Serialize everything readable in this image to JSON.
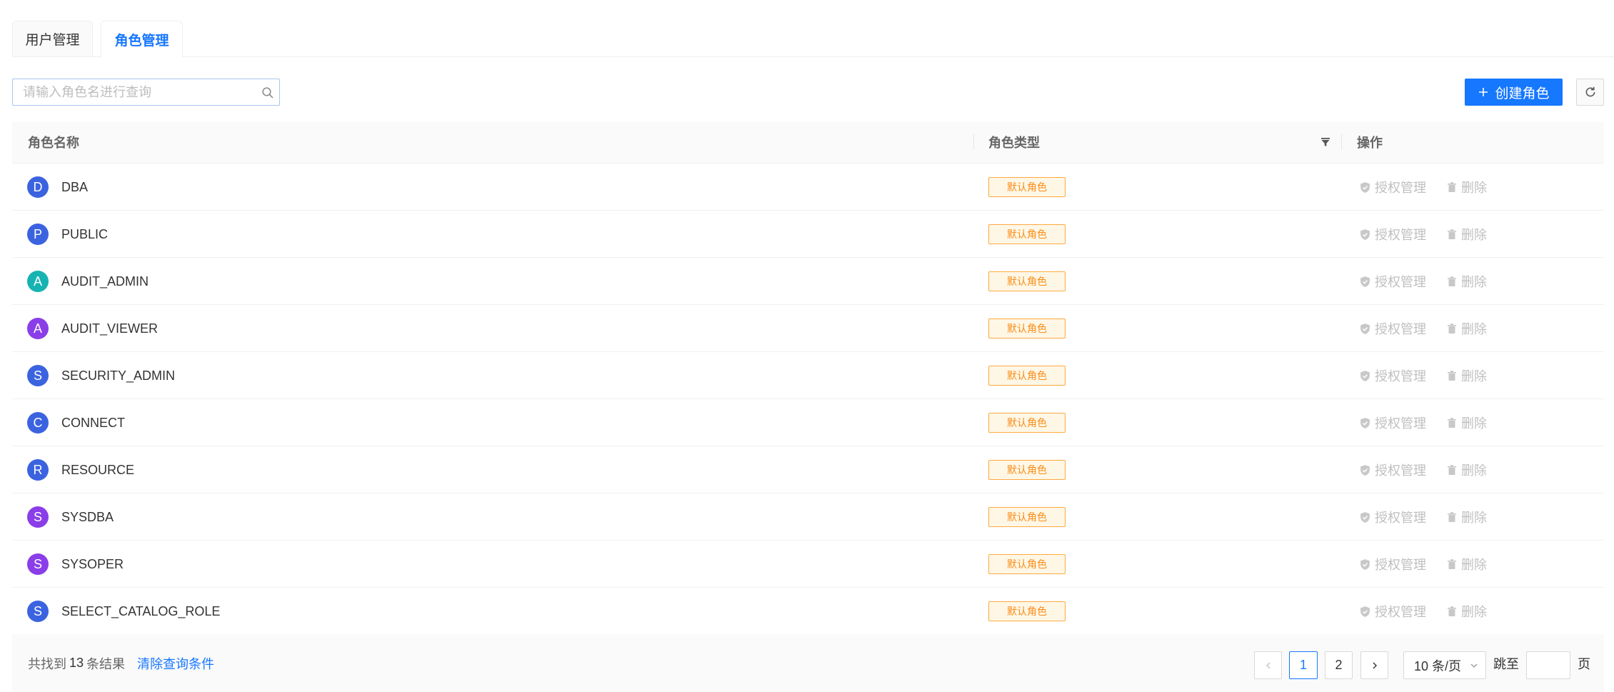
{
  "tabs": [
    {
      "label": "用户管理",
      "active": false
    },
    {
      "label": "角色管理",
      "active": true
    }
  ],
  "search": {
    "placeholder": "请输入角色名进行查询",
    "value": "",
    "icon": "search-icon"
  },
  "toolbar": {
    "create_label": "创建角色",
    "create_icon": "plus-icon",
    "refresh_icon": "refresh-icon"
  },
  "table": {
    "columns": {
      "name": "角色名称",
      "type": "角色类型",
      "actions": "操作"
    },
    "type_filter_icon": "filter-icon",
    "action_labels": {
      "grant": "授权管理",
      "delete": "删除"
    },
    "action_icons": {
      "grant": "shield-icon",
      "delete": "trash-icon"
    },
    "actions_enabled": false,
    "rows": [
      {
        "initial": "D",
        "name": "DBA",
        "type": "默认角色",
        "avatar_color": "#3b63e0"
      },
      {
        "initial": "P",
        "name": "PUBLIC",
        "type": "默认角色",
        "avatar_color": "#3b63e0"
      },
      {
        "initial": "A",
        "name": "AUDIT_ADMIN",
        "type": "默认角色",
        "avatar_color": "#17b3b3"
      },
      {
        "initial": "A",
        "name": "AUDIT_VIEWER",
        "type": "默认角色",
        "avatar_color": "#8a3ee8"
      },
      {
        "initial": "S",
        "name": "SECURITY_ADMIN",
        "type": "默认角色",
        "avatar_color": "#3b63e0"
      },
      {
        "initial": "C",
        "name": "CONNECT",
        "type": "默认角色",
        "avatar_color": "#3b63e0"
      },
      {
        "initial": "R",
        "name": "RESOURCE",
        "type": "默认角色",
        "avatar_color": "#3b63e0"
      },
      {
        "initial": "S",
        "name": "SYSDBA",
        "type": "默认角色",
        "avatar_color": "#8a3ee8"
      },
      {
        "initial": "S",
        "name": "SYSOPER",
        "type": "默认角色",
        "avatar_color": "#8a3ee8"
      },
      {
        "initial": "S",
        "name": "SELECT_CATALOG_ROLE",
        "type": "默认角色",
        "avatar_color": "#3b63e0"
      }
    ]
  },
  "footer": {
    "total_prefix": "共找到",
    "total": "13",
    "total_suffix": "条结果",
    "clear_label": "清除查询条件"
  },
  "pagination": {
    "pages": [
      "1",
      "2"
    ],
    "current": "1",
    "page_size": "10 条/页",
    "jump_label": "跳至",
    "jump_value": "",
    "page_suffix": "页"
  },
  "colors": {
    "primary": "#1677ff",
    "tag_border": "#ffa940",
    "tag_bg": "#fff7e6",
    "tag_text": "#fa8c16",
    "disabled": "#bfbfbf"
  }
}
